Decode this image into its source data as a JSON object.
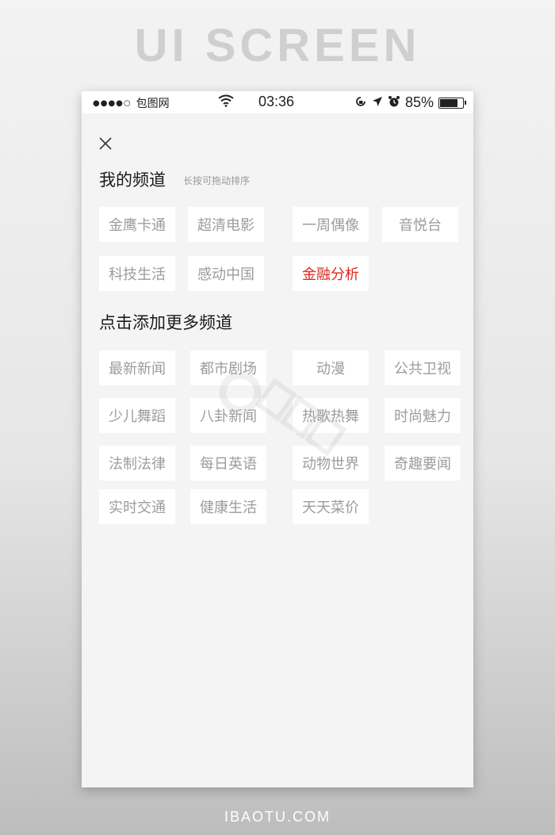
{
  "banner": "UI SCREEN",
  "footer": "IBAOTU.COM",
  "status_bar": {
    "signal_dots": "●●●●○",
    "carrier": "包图网",
    "time": "03:36",
    "battery_percent": "85%",
    "battery_level": 0.85
  },
  "my_channels": {
    "title": "我的频道",
    "hint": "长按可拖动排序",
    "items": [
      "金鹰卡通",
      "超清电影",
      "一周偶像",
      "音悦台",
      "科技生活",
      "感动中国",
      "金融分析"
    ],
    "active_item": "金融分析"
  },
  "more_channels": {
    "title": "点击添加更多频道",
    "items": [
      "最新新闻",
      "都市剧场",
      "动漫",
      "公共卫视",
      "少儿舞蹈",
      "八卦新闻",
      "热歌热舞",
      "时尚魅力",
      "法制法律",
      "每日英语",
      "动物世界",
      "奇趣要闻",
      "实时交通",
      "健康生活",
      "天天菜价"
    ]
  },
  "colors": {
    "active": "#e0261b",
    "tag_text": "#9c9c9c",
    "background": "#f4f4f4"
  }
}
